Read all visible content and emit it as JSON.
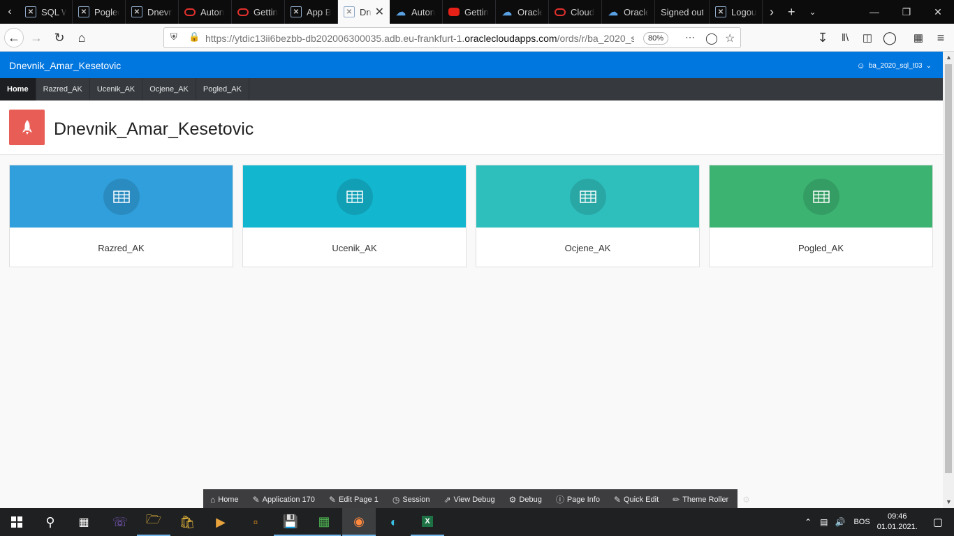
{
  "browser": {
    "tabs": [
      {
        "title": "SQL W",
        "favicon": "apex-icon"
      },
      {
        "title": "Pogled",
        "favicon": "apex-icon"
      },
      {
        "title": "Dnevn",
        "favicon": "apex-icon"
      },
      {
        "title": "Auton",
        "favicon": "oracle-icon"
      },
      {
        "title": "Gettin",
        "favicon": "oracle-icon"
      },
      {
        "title": "App B",
        "favicon": "apex-icon"
      },
      {
        "title": "Dn",
        "favicon": "apex-icon",
        "active": true
      },
      {
        "title": "Auton",
        "favicon": "cloud-icon"
      },
      {
        "title": "Gettin",
        "favicon": "youtube-icon"
      },
      {
        "title": "Oracle",
        "favicon": "cloud-icon"
      },
      {
        "title": "Cloud",
        "favicon": "oracle-icon"
      },
      {
        "title": "Oracle",
        "favicon": "cloud-icon"
      },
      {
        "title": "Signed out",
        "favicon": ""
      },
      {
        "title": "Logou",
        "favicon": "apex-icon"
      }
    ],
    "url_prefix": "https://ytdic13ii6bezbb-db202006300035.adb.eu-frankfurt-1.",
    "url_domain": "oraclecloudapps.com",
    "url_suffix": "/ords/r/ba_2020_s",
    "zoom": "80%"
  },
  "app": {
    "title": "Dnevnik_Amar_Kesetovic",
    "user": "ba_2020_sql_t03",
    "nav": [
      "Home",
      "Razred_AK",
      "Ucenik_AK",
      "Ocjene_AK",
      "Pogled_AK"
    ],
    "page_title": "Dnevnik_Amar_Kesetovic",
    "cards": [
      {
        "label": "Razred_AK",
        "color": "#309fdb"
      },
      {
        "label": "Ucenik_AK",
        "color": "#13b6cf"
      },
      {
        "label": "Ocjene_AK",
        "color": "#2ebfbc"
      },
      {
        "label": "Pogled_AK",
        "color": "#3cb371"
      }
    ]
  },
  "devbar": [
    "Home",
    "Application 170",
    "Edit Page 1",
    "Session",
    "View Debug",
    "Debug",
    "Page Info",
    "Quick Edit",
    "Theme Roller"
  ],
  "taskbar": {
    "language": "BOS",
    "time": "09:46",
    "date": "01.01.2021."
  }
}
